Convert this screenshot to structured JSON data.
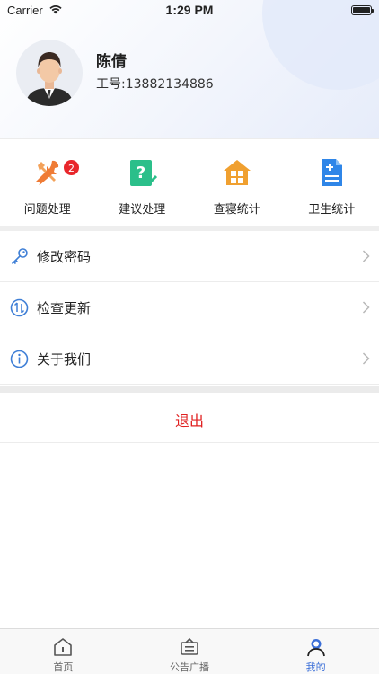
{
  "status_bar": {
    "carrier": "Carrier",
    "time": "1:29 PM"
  },
  "profile": {
    "name": "陈倩",
    "employee_id": "工号:13882134886"
  },
  "quick_actions": [
    {
      "label": "问题处理",
      "icon": "tools-icon",
      "badge": "2",
      "color": "#f08a3c"
    },
    {
      "label": "建议处理",
      "icon": "suggestion-icon",
      "color": "#2bbf8a"
    },
    {
      "label": "查寝统计",
      "icon": "dorm-icon",
      "color": "#f0a030"
    },
    {
      "label": "卫生统计",
      "icon": "hygiene-icon",
      "color": "#2f86e8"
    }
  ],
  "menu": [
    {
      "label": "修改密码",
      "icon": "key-icon"
    },
    {
      "label": "检查更新",
      "icon": "update-icon"
    },
    {
      "label": "关于我们",
      "icon": "info-icon"
    }
  ],
  "logout_label": "退出",
  "tabs": [
    {
      "label": "首页",
      "icon": "home-icon",
      "active": false
    },
    {
      "label": "公告广播",
      "icon": "announcement-icon",
      "active": false
    },
    {
      "label": "我的",
      "icon": "profile-icon",
      "active": true
    }
  ],
  "colors": {
    "accent": "#3b6fd8",
    "logout": "#e02020",
    "badge": "#e8262b"
  }
}
